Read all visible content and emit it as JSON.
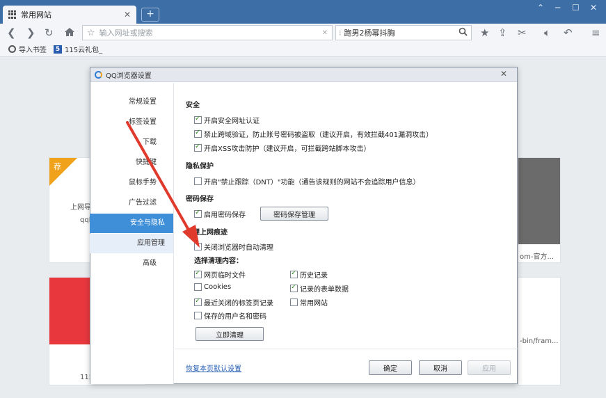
{
  "tabs": {
    "active_title": "常用网站",
    "new_tab_label": "+"
  },
  "window_controls": [
    "⌃",
    "─",
    "☐",
    "✕"
  ],
  "toolbar": {
    "url_placeholder": "输入网址或搜索",
    "search_value": "跑男2杨幂抖胸"
  },
  "bookmarks": [
    {
      "label": "导入书签"
    },
    {
      "label": "115云礼包_"
    }
  ],
  "background": {
    "ribbon": "荐",
    "text_left1": "上网导",
    "text_left2": "qqb",
    "text_right1": "om-官方...",
    "text_right2": "-bin/fram...",
    "text_bottom": "115"
  },
  "dialog": {
    "title": "QQ浏览器设置",
    "nav": [
      {
        "label": "常规设置"
      },
      {
        "label": "标签设置"
      },
      {
        "label": "下载"
      },
      {
        "label": "快捷键"
      },
      {
        "label": "鼠标手势"
      },
      {
        "label": "广告过滤"
      },
      {
        "label": "安全与隐私"
      },
      {
        "label": "应用管理"
      },
      {
        "label": "高级"
      }
    ],
    "security": {
      "heading": "安全",
      "opt1": "开启安全网址认证",
      "opt2": "禁止跨域验证，防止账号密码被盗取（建议开启，有效拦截401漏洞攻击）",
      "opt3": "开启XSS攻击防护（建议开启，可拦截跨站脚本攻击）"
    },
    "privacy": {
      "heading": "隐私保护",
      "opt1": "开启\"禁止跟踪（DNT）\"功能（通告该规则的网站不会追踪用户信息）"
    },
    "password": {
      "heading": "密码保存",
      "opt1": "启用密码保存",
      "manage_button": "密码保存管理"
    },
    "clear": {
      "heading": "清理上网痕迹",
      "auto_clear": "关闭浏览器时自动清理",
      "content_heading": "选择清理内容：",
      "items": {
        "temp_files": "网页临时文件",
        "history": "历史记录",
        "cookies": "Cookies",
        "form_data": "记录的表单数据",
        "closed_tabs": "最近关闭的标签页记录",
        "frequent_sites": "常用网站",
        "saved_credentials": "保存的用户名和密码"
      },
      "clear_now_button": "立即清理"
    },
    "footer": {
      "restore_link": "恢复本页默认设置",
      "ok": "确定",
      "cancel": "取消",
      "apply": "应用"
    }
  },
  "colors": {
    "tabstrip": "#3d6ea6",
    "nav_active": "#3f8fd8",
    "arrow": "#e03a2c",
    "ribbon": "#f0a21a"
  }
}
